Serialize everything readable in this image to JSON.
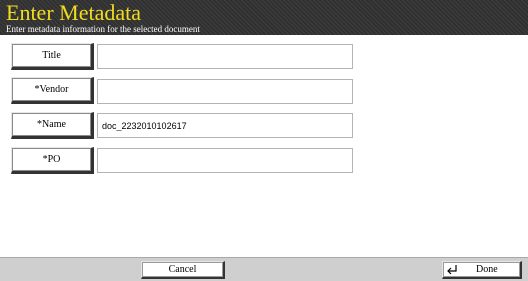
{
  "header": {
    "title": "Enter Metadata",
    "subtitle": "Enter metadata information for the selected document"
  },
  "fields": [
    {
      "label": "Title",
      "value": ""
    },
    {
      "label": "*Vendor",
      "value": ""
    },
    {
      "label": "*Name",
      "value": "doc_2232010102617"
    },
    {
      "label": "*PO",
      "value": ""
    }
  ],
  "footer": {
    "cancel_label": "Cancel",
    "done_label": "Done",
    "done_icon": "enter-icon"
  },
  "colors": {
    "title_color": "#f2dd1c",
    "header_bg": "#303030",
    "footer_bg": "#cfcfcf"
  }
}
